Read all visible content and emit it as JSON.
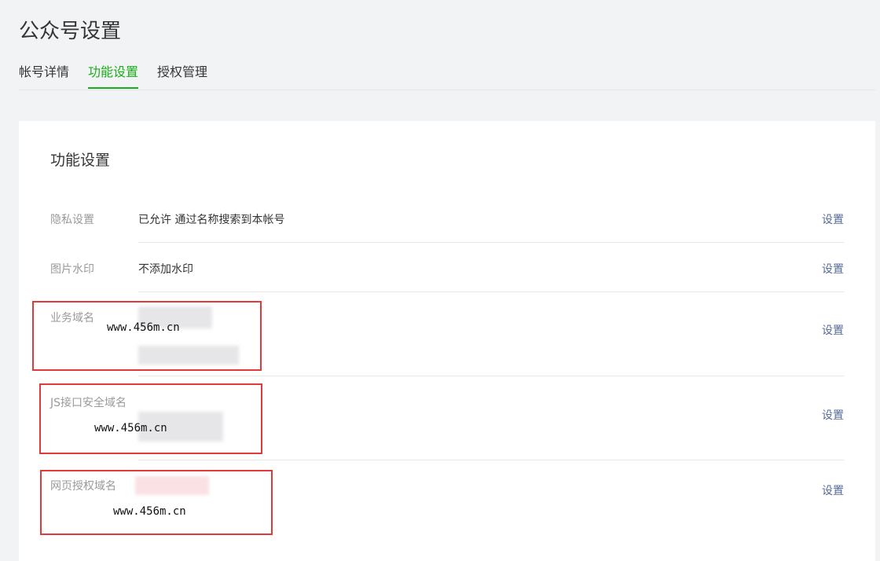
{
  "page": {
    "title": "公众号设置"
  },
  "tabs": [
    {
      "label": "帐号详情",
      "active": false
    },
    {
      "label": "功能设置",
      "active": true
    },
    {
      "label": "授权管理",
      "active": false
    }
  ],
  "section": {
    "title": "功能设置",
    "rows": [
      {
        "label": "隐私设置",
        "value": "已允许 通过名称搜索到本帐号",
        "action": "设置"
      },
      {
        "label": "图片水印",
        "value": "不添加水印",
        "action": "设置"
      },
      {
        "label": "业务域名",
        "value": "www.456m.cn",
        "action": "设置"
      },
      {
        "label": "JS接口安全域名",
        "value": "www.456m.cn",
        "action": "设置"
      },
      {
        "label": "网页授权域名",
        "value": "www.456m.cn",
        "action": "设置"
      }
    ]
  },
  "colors": {
    "accent": "#1aad19",
    "link": "#576b95",
    "highlight_box": "#e03b3b"
  }
}
